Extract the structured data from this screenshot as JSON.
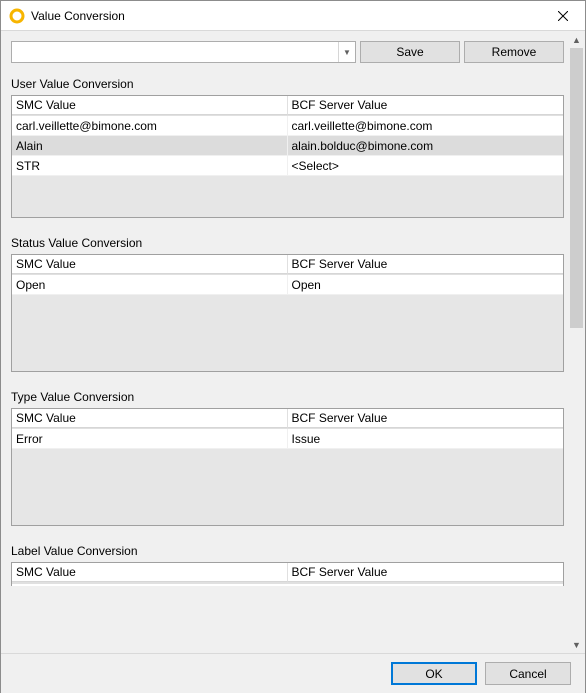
{
  "window": {
    "title": "Value Conversion"
  },
  "toolbar": {
    "combo_value": "",
    "save_label": "Save",
    "remove_label": "Remove"
  },
  "columns": {
    "smc": "SMC Value",
    "bcf": "BCF Server Value"
  },
  "sections": {
    "user": {
      "title": "User Value Conversion",
      "rows": [
        {
          "smc": "carl.veillette@bimone.com",
          "bcf": "carl.veillette@bimone.com"
        },
        {
          "smc": "Alain",
          "bcf": "alain.bolduc@bimone.com"
        },
        {
          "smc": "STR",
          "bcf": "<Select>"
        }
      ]
    },
    "status": {
      "title": "Status Value Conversion",
      "rows": [
        {
          "smc": "Open",
          "bcf": "Open"
        }
      ]
    },
    "type": {
      "title": "Type Value Conversion",
      "rows": [
        {
          "smc": "Error",
          "bcf": "Issue"
        }
      ]
    },
    "label": {
      "title": "Label Value Conversion",
      "rows": []
    }
  },
  "footer": {
    "ok_label": "OK",
    "cancel_label": "Cancel"
  }
}
